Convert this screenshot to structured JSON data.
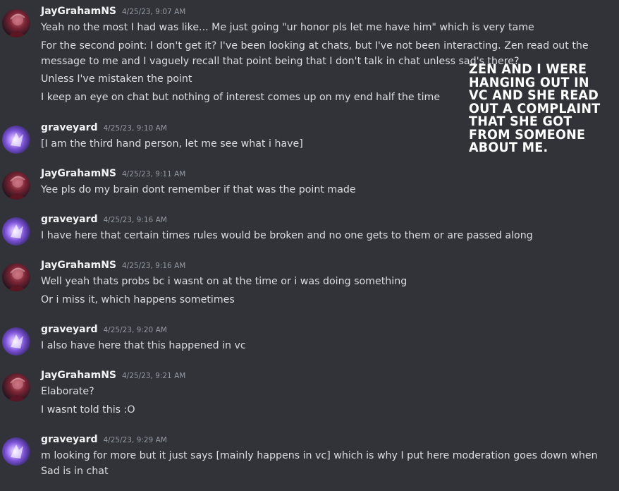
{
  "messages": [
    {
      "author": "JayGrahamNS",
      "avatar": "jaygraham-avatar",
      "time": "4/25/23, 9:07 AM",
      "lines": [
        "Yeah no the most I had was like... Me just going \"ur honor pls let me have him\" which is very tame",
        "For the second point: I don't get it? I've been looking at chats, but I've not been interacting. Zen read out the message to me and I vaguely recall that point being that I don't talk in chat unless sad's there?",
        "Unless I've mistaken the point",
        "I keep an eye on chat but nothing of interest comes up on my end half the time"
      ]
    },
    {
      "author": "graveyard",
      "avatar": "graveyard-avatar",
      "time": "4/25/23, 9:10 AM",
      "lines": [
        "[I am the third hand person, let me see what i have]"
      ]
    },
    {
      "author": "JayGrahamNS",
      "avatar": "jaygraham-avatar",
      "time": "4/25/23, 9:11 AM",
      "lines": [
        "Yee pls do my brain dont remember if that was the point made"
      ]
    },
    {
      "author": "graveyard",
      "avatar": "graveyard-avatar",
      "time": "4/25/23, 9:16 AM",
      "lines": [
        "I have here that certain times rules would be broken and no one gets to them or are passed along"
      ]
    },
    {
      "author": "JayGrahamNS",
      "avatar": "jaygraham-avatar",
      "time": "4/25/23, 9:16 AM",
      "lines": [
        "Well yeah thats probs bc i wasnt on at the time or i was doing something",
        "Or i miss it, which happens sometimes"
      ]
    },
    {
      "author": "graveyard",
      "avatar": "graveyard-avatar",
      "time": "4/25/23, 9:20 AM",
      "lines": [
        "I also have here that this happened in vc"
      ]
    },
    {
      "author": "JayGrahamNS",
      "avatar": "jaygraham-avatar",
      "time": "4/25/23, 9:21 AM",
      "lines": [
        "Elaborate?",
        "I wasnt told this :O"
      ]
    },
    {
      "author": "graveyard",
      "avatar": "graveyard-avatar",
      "time": "4/25/23, 9:29 AM",
      "lines": [
        "m looking for more but it just says [mainly happens in vc] which is why I put here moderation goes down when Sad is in chat"
      ]
    }
  ],
  "overlay_note": "ZEN AND I WERE HANGING OUT IN VC AND SHE READ OUT A COMPLAINT THAT SHE GOT FROM SOMEONE ABOUT ME."
}
